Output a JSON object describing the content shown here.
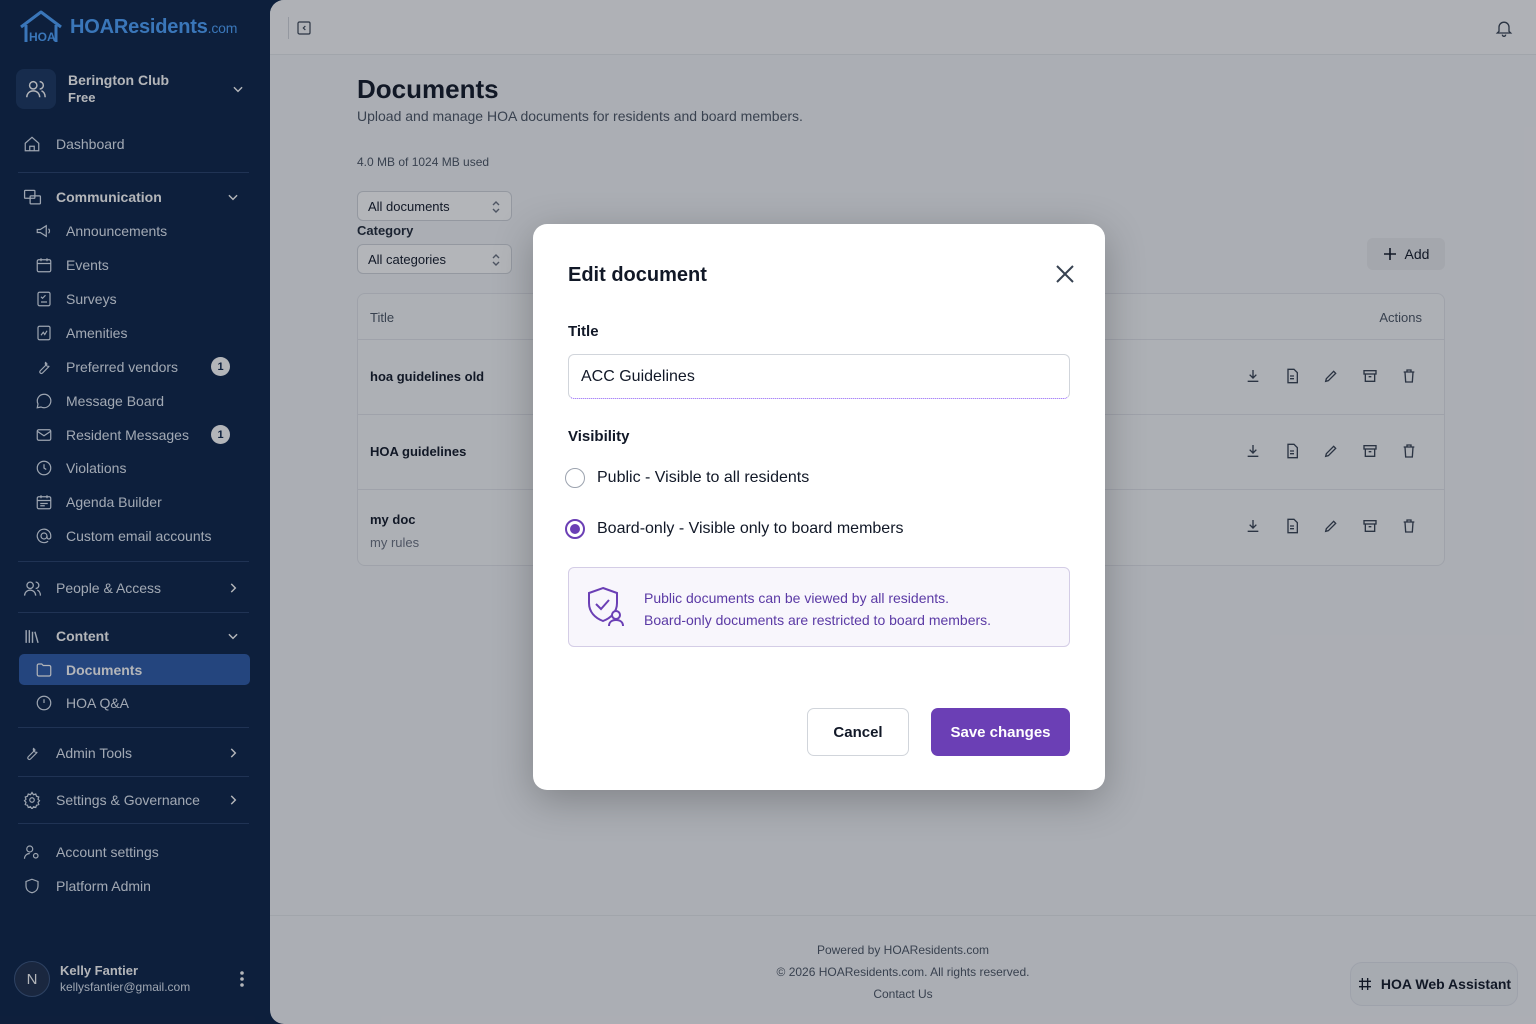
{
  "brand": {
    "name": "HOAResidents",
    "tld": ".com",
    "color": "#4da3ff"
  },
  "club": {
    "name": "Berington Club",
    "plan": "Free"
  },
  "sidebar": {
    "dashboard": "Dashboard",
    "communication": "Communication",
    "communication_items": [
      {
        "label": "Announcements",
        "icon": "megaphone-icon"
      },
      {
        "label": "Events",
        "icon": "calendar-icon"
      },
      {
        "label": "Surveys",
        "icon": "survey-icon"
      },
      {
        "label": "Amenities",
        "icon": "amenities-icon"
      },
      {
        "label": "Preferred vendors",
        "icon": "wrench-icon",
        "badge": "1"
      },
      {
        "label": "Message Board",
        "icon": "chat-icon"
      },
      {
        "label": "Resident Messages",
        "icon": "mail-icon",
        "badge": "1"
      },
      {
        "label": "Violations",
        "icon": "clock-icon"
      },
      {
        "label": "Agenda Builder",
        "icon": "calendar-icon"
      },
      {
        "label": "Custom email accounts",
        "icon": "at-icon"
      }
    ],
    "people_access": "People & Access",
    "content": "Content",
    "content_items": [
      {
        "label": "Documents",
        "icon": "folder-icon",
        "active": true
      },
      {
        "label": "HOA Q&A",
        "icon": "clock-icon"
      }
    ],
    "admin_tools": "Admin Tools",
    "settings_governance": "Settings & Governance",
    "account_settings": "Account settings",
    "platform_admin": "Platform Admin",
    "active_color": "#2d5aa8"
  },
  "user": {
    "initial": "N",
    "name": "Kelly Fantier",
    "email": "kellysfantier@gmail.com"
  },
  "page": {
    "title": "Documents",
    "subtitle": "Upload and manage HOA documents for residents and board members.",
    "usage": "4.0 MB of 1024 MB used",
    "filter_documents": "All documents",
    "category_label": "Category",
    "filter_category": "All categories",
    "add_label": "Add"
  },
  "table": {
    "headers": {
      "title": "Title",
      "actions": "Actions"
    },
    "rows": [
      {
        "title": "hoa guidelines old",
        "description": ""
      },
      {
        "title": "HOA guidelines",
        "description": ""
      },
      {
        "title": "my doc",
        "description": "my rules"
      }
    ]
  },
  "footer": {
    "powered": "Powered by HOAResidents.com",
    "copyright": "© 2026 HOAResidents.com. All rights reserved.",
    "contact": "Contact Us"
  },
  "assistant": {
    "label": "HOA Web Assistant"
  },
  "modal": {
    "title": "Edit document",
    "title_label": "Title",
    "title_value": "ACC Guidelines",
    "visibility_label": "Visibility",
    "options": [
      {
        "label": "Public - Visible to all residents",
        "selected": false
      },
      {
        "label": "Board-only - Visible only to board members",
        "selected": true
      }
    ],
    "info_line1": "Public documents can be viewed by all residents.",
    "info_line2": "Board-only documents are restricted to board members.",
    "cancel": "Cancel",
    "save": "Save changes",
    "accent": "#6b3fb5"
  }
}
